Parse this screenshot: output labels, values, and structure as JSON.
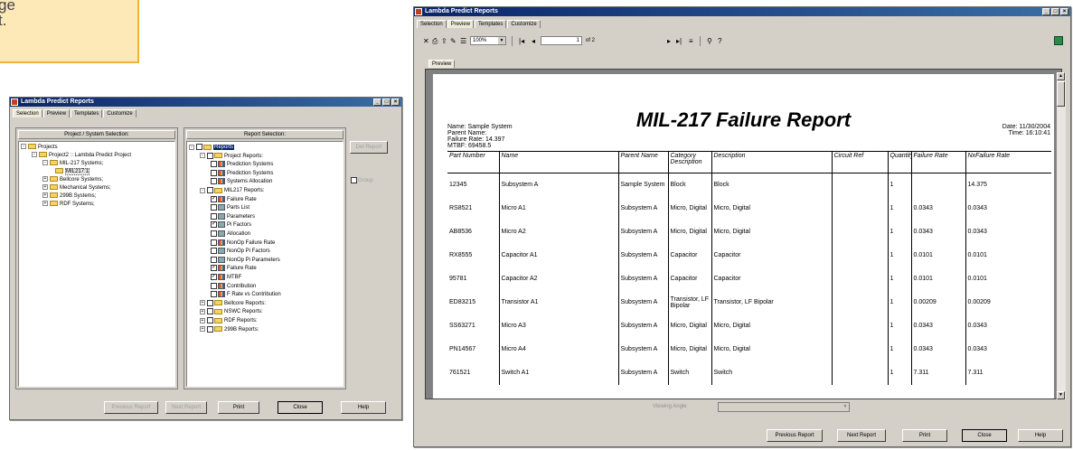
{
  "note": {
    "line1": "ge",
    "line2": "t."
  },
  "small_window": {
    "title": "Lambda Predict Reports",
    "tabs": [
      "Selection",
      "Preview",
      "Templates",
      "Customize"
    ],
    "left_panel_title": "Project / System Selection:",
    "right_panel_title": "Report Selection:",
    "project_tree": [
      {
        "text": "Projects",
        "exp": "-"
      },
      {
        "text": "Project2 :: Lambda Predict Project",
        "exp": "-"
      },
      {
        "text": "MIL-217 Systems;",
        "exp": "-"
      },
      {
        "text": "MIL217:1",
        "exp": ""
      },
      {
        "text": "Bellcore Systems;",
        "exp": "+"
      },
      {
        "text": "Mechanical Systems;",
        "exp": "+"
      },
      {
        "text": "299B Systems;",
        "exp": "+"
      },
      {
        "text": "RDF Systems;",
        "exp": "+"
      }
    ],
    "report_tree": [
      {
        "text": "Reports",
        "exp": "-",
        "checked": false
      },
      {
        "text": "Project Reports:",
        "exp": "-",
        "checked": false
      },
      {
        "text": "Prediction Systems",
        "exp": "",
        "checked": false
      },
      {
        "text": "Prediction Systems",
        "exp": "",
        "checked": false
      },
      {
        "text": "Systems Allocation",
        "exp": "",
        "checked": false
      },
      {
        "text": "MIL217 Reports:",
        "exp": "-",
        "checked": false
      },
      {
        "text": "Failure Rate",
        "exp": "",
        "checked": true
      },
      {
        "text": "Parts List",
        "exp": "",
        "checked": false
      },
      {
        "text": "Parameters",
        "exp": "",
        "checked": false
      },
      {
        "text": "Pi Factors",
        "exp": "",
        "checked": true
      },
      {
        "text": "Allocation",
        "exp": "",
        "checked": false
      },
      {
        "text": "NonOp Failure Rate",
        "exp": "",
        "checked": false
      },
      {
        "text": "NonOp Pi Factors",
        "exp": "",
        "checked": false
      },
      {
        "text": "NonOp Pi Parameters",
        "exp": "",
        "checked": false
      },
      {
        "text": "Failure Rate",
        "exp": "",
        "checked": true
      },
      {
        "text": "MTBF",
        "exp": "",
        "checked": true
      },
      {
        "text": "Contribution",
        "exp": "",
        "checked": false
      },
      {
        "text": "F Rate vs Contribution",
        "exp": "",
        "checked": false
      },
      {
        "text": "Bellcore Reports:",
        "exp": "+",
        "checked": false
      },
      {
        "text": "NSWC Reports:",
        "exp": "+",
        "checked": false
      },
      {
        "text": "RDF Reports:",
        "exp": "+",
        "checked": false
      },
      {
        "text": "299B Reports:",
        "exp": "+",
        "checked": false
      }
    ],
    "del_report": "Del Report",
    "group_label": "Group",
    "buttons": [
      "Previous Report",
      "Next Report",
      "Print",
      "Close",
      "Help"
    ]
  },
  "main_window": {
    "title": "Lambda Predict Reports",
    "tabs": [
      "Selection",
      "Preview",
      "Templates",
      "Customize"
    ],
    "zoom": "100%",
    "page_current": "1",
    "page_total": "of 2",
    "preview_tab": "Preview",
    "viewing_angle_label": "Viewing Angle",
    "buttons": [
      "Previous Report",
      "Next Report",
      "Print",
      "Close",
      "Help"
    ]
  },
  "report": {
    "title": "MIL-217 Failure Report",
    "header_left": [
      "Name: Sample System",
      "Parent Name:",
      "Failure Rate: 14.397",
      "MTBF: 69458.5"
    ],
    "header_right": [
      "Date: 11/30/2004",
      "Time: 16:10:41"
    ],
    "columns": [
      "Part Number",
      "Name",
      "Parent Name",
      "Category Description",
      "Description",
      "Circuit Ref",
      "Quantity",
      "Failure Rate",
      "NxFailure Rate"
    ],
    "rows": [
      [
        "12345",
        "Subsystem A",
        "Sample System",
        "Block",
        "Block",
        "",
        "1",
        "",
        "14.375"
      ],
      [
        "RS8521",
        "Micro A1",
        "Subsystem A",
        "Micro, Digital",
        "Micro, Digital",
        "",
        "1",
        "0.0343",
        "0.0343"
      ],
      [
        "AB8536",
        "Micro A2",
        "Subsystem A",
        "Micro, Digital",
        "Micro, Digital",
        "",
        "1",
        "0.0343",
        "0.0343"
      ],
      [
        "RX8555",
        "Capacitor A1",
        "Subsystem A",
        "Capacitor",
        "Capacitor",
        "",
        "1",
        "0.0101",
        "0.0101"
      ],
      [
        "95781",
        "Capacitor A2",
        "Subsystem A",
        "Capacitor",
        "Capacitor",
        "",
        "1",
        "0.0101",
        "0.0101"
      ],
      [
        "ED83215",
        "Transistor A1",
        "Subsystem A",
        "Transistor, LF Bipolar",
        "Transistor, LF Bipolar",
        "",
        "1",
        "0.00209",
        "0.00209"
      ],
      [
        "SS63271",
        "Micro A3",
        "Subsystem A",
        "Micro, Digital",
        "Micro, Digital",
        "",
        "1",
        "0.0343",
        "0.0343"
      ],
      [
        "PN14567",
        "Micro A4",
        "Subsystem A",
        "Micro, Digital",
        "Micro, Digital",
        "",
        "1",
        "0.0343",
        "0.0343"
      ],
      [
        "761521",
        "Switch A1",
        "Subsystem A",
        "Switch",
        "Switch",
        "",
        "1",
        "7.311",
        "7.311"
      ]
    ]
  }
}
